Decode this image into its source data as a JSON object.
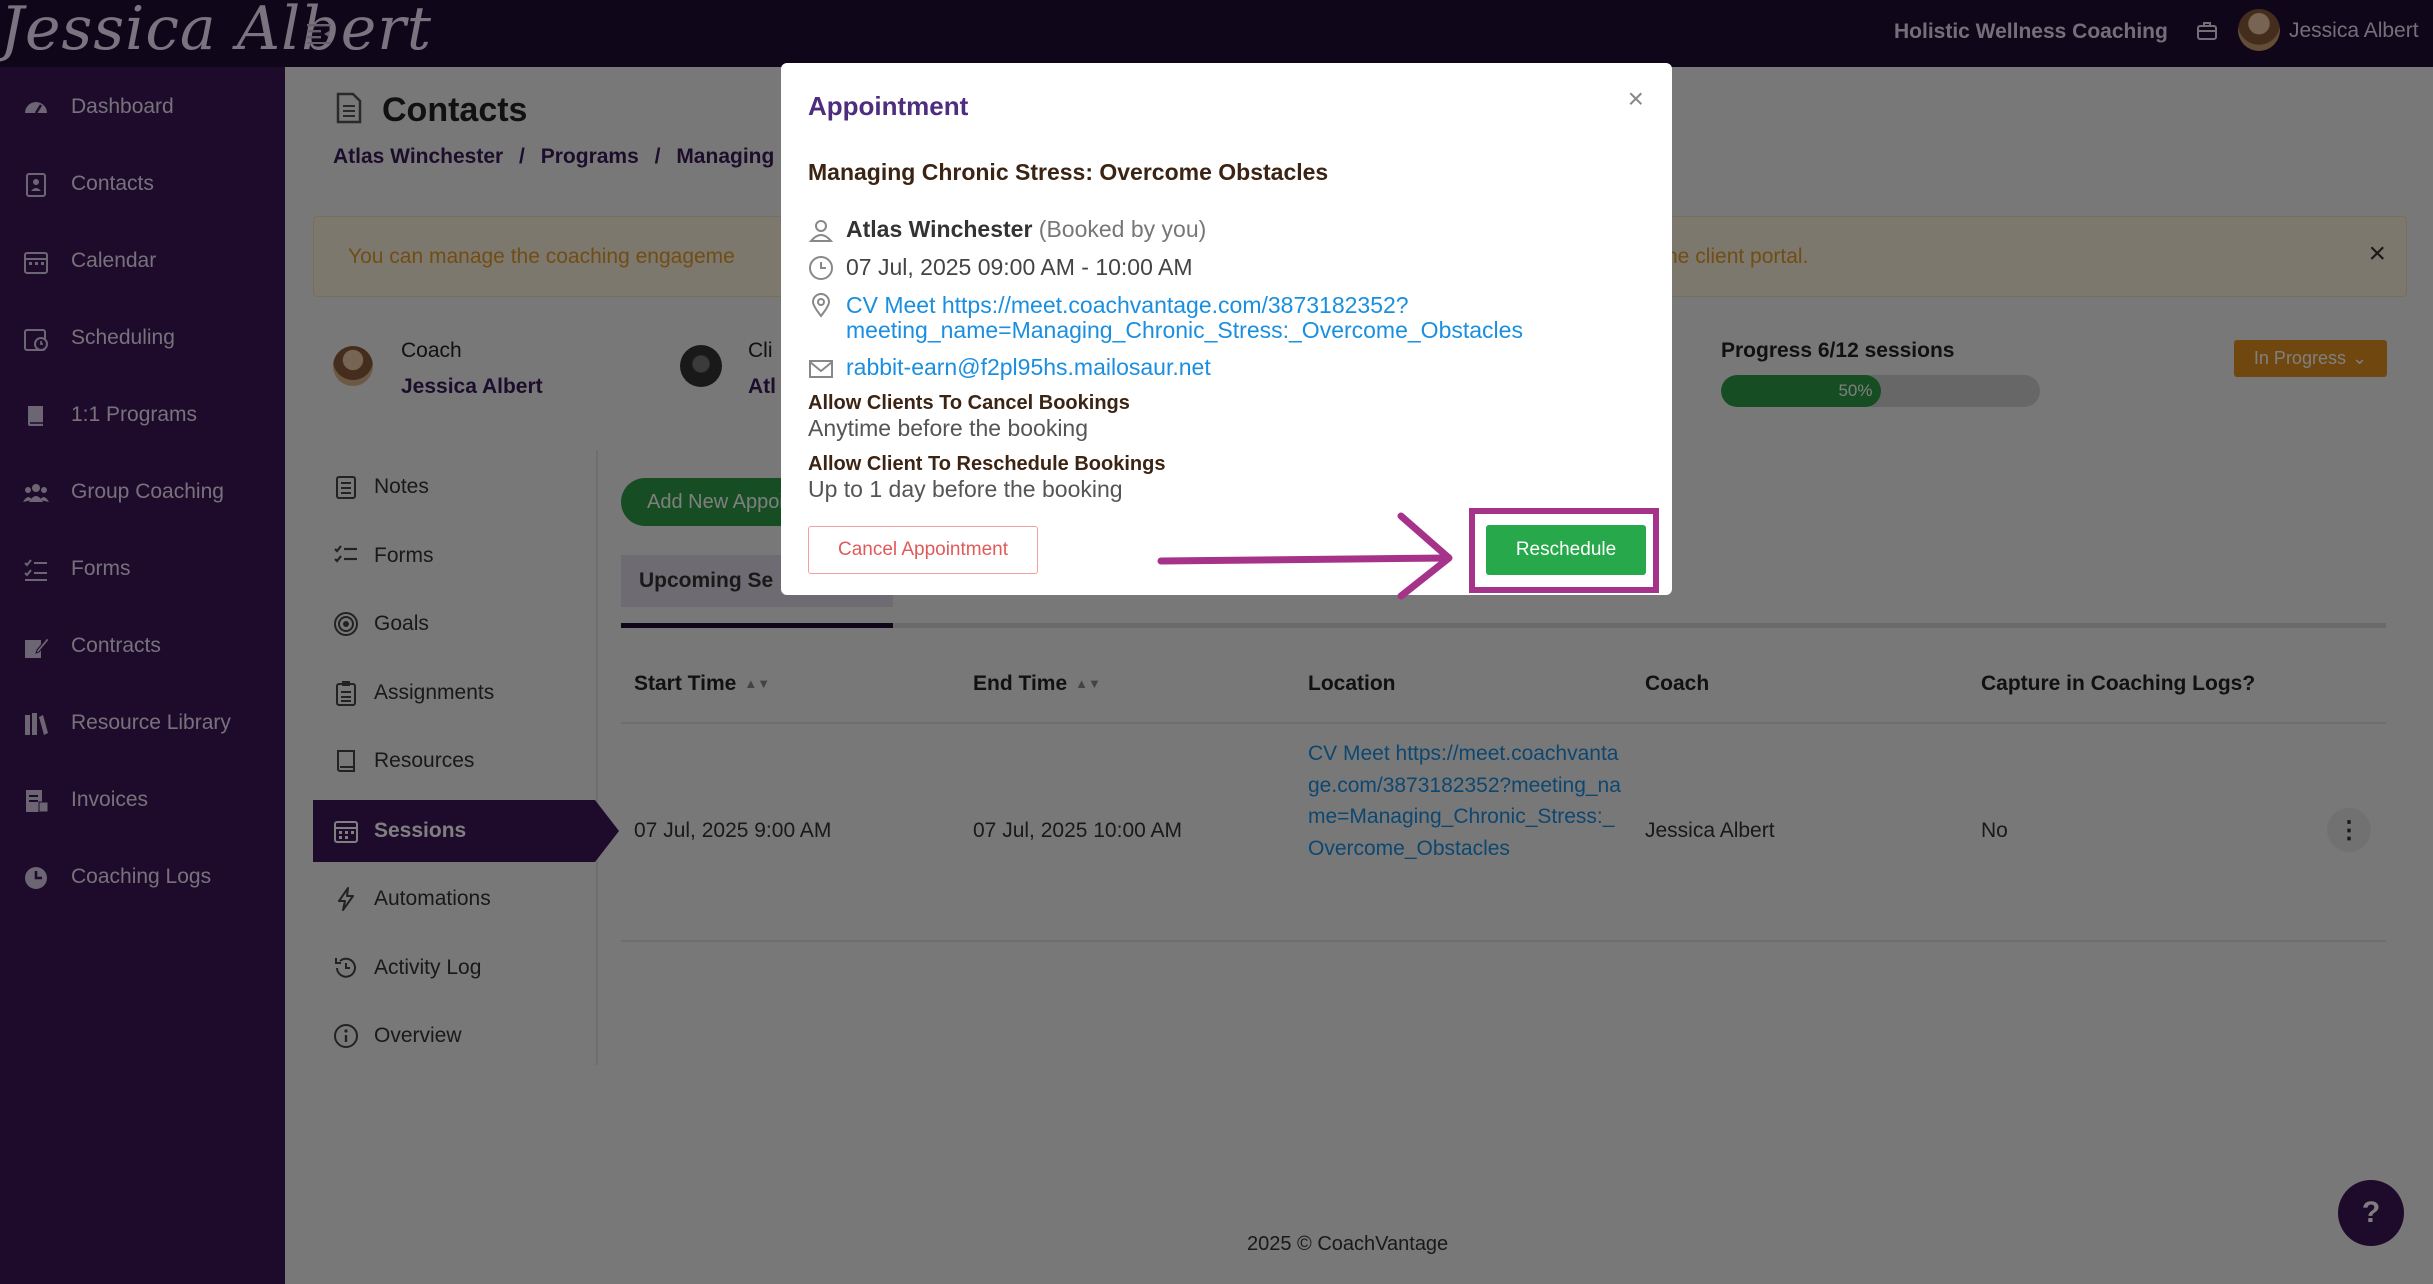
{
  "topbar": {
    "logo": "Jessica Albert",
    "workspace": "Holistic Wellness Coaching",
    "user_name": "Jessica Albert"
  },
  "sidebar": {
    "items": [
      {
        "label": "Dashboard",
        "icon": "dashboard-icon"
      },
      {
        "label": "Contacts",
        "icon": "contacts-icon"
      },
      {
        "label": "Calendar",
        "icon": "calendar-icon"
      },
      {
        "label": "Scheduling",
        "icon": "scheduling-icon"
      },
      {
        "label": "1:1 Programs",
        "icon": "book-icon"
      },
      {
        "label": "Group Coaching",
        "icon": "group-icon"
      },
      {
        "label": "Forms",
        "icon": "forms-icon"
      },
      {
        "label": "Contracts",
        "icon": "contract-icon"
      },
      {
        "label": "Resource Library",
        "icon": "library-icon"
      },
      {
        "label": "Invoices",
        "icon": "invoice-icon"
      },
      {
        "label": "Coaching Logs",
        "icon": "clock-icon"
      }
    ]
  },
  "page": {
    "title": "Contacts",
    "breadcrumb": [
      "Atlas Winchester",
      "/",
      "Programs",
      "/",
      "Managing"
    ],
    "alert_left": "You can manage the coaching engageme",
    "alert_right": "he client portal.",
    "alert_close": "×"
  },
  "engagement": {
    "coach_label": "Coach",
    "coach_name": "Jessica Albert",
    "client_label": "Cli",
    "client_name": "Atl",
    "progress_label": "Progress 6/12 sessions",
    "progress_value": 0.5,
    "progress_pct": "50%",
    "status": "In Progress",
    "status_chevron": "⌄"
  },
  "subnav": {
    "items": [
      {
        "label": "Notes",
        "icon": "notes-icon"
      },
      {
        "label": "Forms",
        "icon": "forms-icon"
      },
      {
        "label": "Goals",
        "icon": "target-icon"
      },
      {
        "label": "Assignments",
        "icon": "clipboard-icon"
      },
      {
        "label": "Resources",
        "icon": "book-icon"
      },
      {
        "label": "Sessions",
        "icon": "calendar-icon"
      },
      {
        "label": "Automations",
        "icon": "bolt-icon"
      },
      {
        "label": "Activity Log",
        "icon": "history-icon"
      },
      {
        "label": "Overview",
        "icon": "info-icon"
      }
    ],
    "active_index": 5
  },
  "sessions": {
    "add_button": "Add New Appoi",
    "tab_upcoming": "Upcoming Se",
    "columns": [
      "Start Time",
      "End Time",
      "Location",
      "Coach",
      "Capture in Coaching Logs?"
    ],
    "sort_glyph": "▲▼",
    "row": {
      "start": "07 Jul, 2025 9:00 AM",
      "end": "07 Jul, 2025 10:00 AM",
      "location": "CV Meet https://meet.coachvantage.com/3873182352?meeting_name=Managing_Chronic_Stress:_Overcome_Obstacles",
      "coach": "Jessica Albert",
      "capture": "No",
      "menu": "⋮"
    }
  },
  "footer": {
    "text": "2025 © CoachVantage"
  },
  "help": {
    "label": "?"
  },
  "modal": {
    "title": "Appointment",
    "close": "×",
    "program_title": "Managing Chronic Stress: Overcome Obstacles",
    "client_name": "Atlas Winchester",
    "booked_by": "(Booked by you)",
    "datetime": "07 Jul, 2025 09:00 AM - 10:00 AM",
    "location_line1": "CV Meet https://meet.coachvantage.com/3873182352?",
    "location_line2": "meeting_name=Managing_Chronic_Stress:_Overcome_Obstacles",
    "email": "rabbit-earn@f2pl95hs.mailosaur.net",
    "cancel_policy_label": "Allow Clients To Cancel Bookings",
    "cancel_policy_value": "Anytime before the booking",
    "reschedule_policy_label": "Allow Client To Reschedule Bookings",
    "reschedule_policy_value": "Up to 1 day before the booking",
    "cancel_button": "Cancel Appointment",
    "reschedule_button": "Reschedule"
  },
  "annotation": {
    "color": "#a6338a"
  }
}
